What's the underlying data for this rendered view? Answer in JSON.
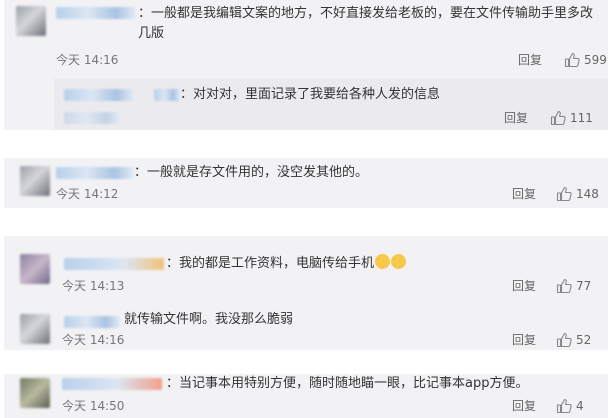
{
  "colors": {
    "card": "#f2f2f5",
    "subcard": "#ebebef",
    "username": "#a9c3e2"
  },
  "comments": [
    {
      "text": "：一般都是我编辑文案的地方，不好直接发给老板的，要在文件传输助手里多改几版",
      "time": "今天 14:16",
      "reply": "回复",
      "likes": "599",
      "sub": {
        "text": "：对对对，里面记录了我要给各种人发的信息",
        "reply": "回复",
        "likes": "111"
      }
    },
    {
      "text": "：一般就是存文件用的，没空发其他的。",
      "time": "今天 14:12",
      "reply": "回复",
      "likes": "148"
    },
    {
      "text": "：我的都是工作资料，电脑传给手机",
      "time": "今天 14:13",
      "reply": "回复",
      "likes": "77"
    },
    {
      "text": "就传输文件啊。我没那么脆弱",
      "time": "今天 14:16",
      "reply": "回复",
      "likes": "52"
    },
    {
      "text": "：当记事本用特别方便，随时随地瞄一眼，比记事本app方便。",
      "time": "今天 14:50",
      "reply": "回复",
      "likes": "4"
    }
  ]
}
